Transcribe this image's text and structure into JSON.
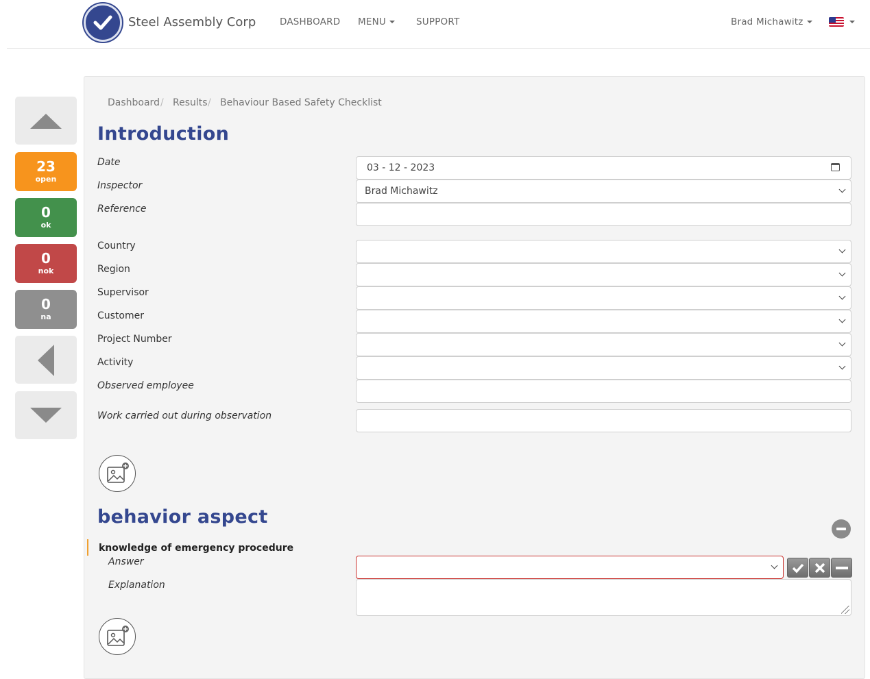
{
  "header": {
    "brand": "Steel Assembly Corp",
    "nav": {
      "dashboard": "DASHBOARD",
      "menu": "MENU",
      "support": "SUPPORT"
    },
    "user": "Brad Michawitz"
  },
  "sidebar": {
    "counters": [
      {
        "value": "23",
        "label": "open",
        "color": "#f7941d"
      },
      {
        "value": "0",
        "label": "ok",
        "color": "#43914c"
      },
      {
        "value": "0",
        "label": "nok",
        "color": "#c14848"
      },
      {
        "value": "0",
        "label": "na",
        "color": "#8f8f8f"
      }
    ]
  },
  "breadcrumb": [
    "Dashboard",
    "Results",
    "Behaviour Based Safety Checklist"
  ],
  "introduction": {
    "title": "Introduction",
    "fields": {
      "date": {
        "label": "Date",
        "value": "03 - 12 - 2023"
      },
      "inspector": {
        "label": "Inspector",
        "value": "Brad Michawitz"
      },
      "reference": {
        "label": "Reference",
        "value": ""
      },
      "country": {
        "label": "Country",
        "value": ""
      },
      "region": {
        "label": "Region",
        "value": ""
      },
      "supervisor": {
        "label": "Supervisor",
        "value": ""
      },
      "customer": {
        "label": "Customer",
        "value": ""
      },
      "project_number": {
        "label": "Project Number",
        "value": ""
      },
      "activity": {
        "label": "Activity",
        "value": ""
      },
      "observed_employee": {
        "label": "Observed employee",
        "value": ""
      },
      "work_carried_out": {
        "label": "Work carried out during observation",
        "value": ""
      }
    }
  },
  "behavior_aspect": {
    "title": "behavior aspect",
    "question": "knowledge of emergency procedure",
    "answer_label": "Answer",
    "answer_value": "",
    "explanation_label": "Explanation",
    "explanation_value": "",
    "answer_buttons": [
      "check-icon",
      "cross-icon",
      "minus-icon"
    ]
  }
}
